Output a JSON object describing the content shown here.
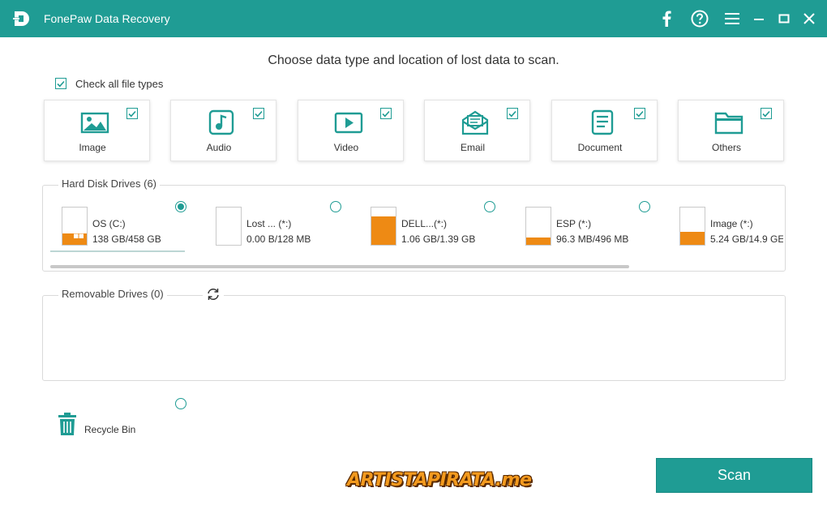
{
  "app": {
    "title": "FonePaw Data Recovery"
  },
  "titlebar_icons": [
    "facebook-icon",
    "help-icon",
    "menu-icon",
    "minimize-icon",
    "maximize-icon",
    "close-icon"
  ],
  "heading": "Choose data type and location of lost data to scan.",
  "check_all": {
    "label": "Check all file types",
    "checked": true
  },
  "file_types": [
    {
      "label": "Image",
      "icon": "image-icon",
      "checked": true
    },
    {
      "label": "Audio",
      "icon": "audio-icon",
      "checked": true
    },
    {
      "label": "Video",
      "icon": "video-icon",
      "checked": true
    },
    {
      "label": "Email",
      "icon": "email-icon",
      "checked": true
    },
    {
      "label": "Document",
      "icon": "document-icon",
      "checked": true
    },
    {
      "label": "Others",
      "icon": "folder-icon",
      "checked": true
    }
  ],
  "hard_disk": {
    "title": "Hard Disk Drives (6)",
    "drives": [
      {
        "name": "OS (C:)",
        "size": "138 GB/458 GB",
        "used_fraction": 0.3,
        "selected": true
      },
      {
        "name": "Lost ... (*:)",
        "size": "0.00  B/128 MB",
        "used_fraction": 0.0,
        "selected": false
      },
      {
        "name": "DELL...(*:)",
        "size": "1.06 GB/1.39 GB",
        "used_fraction": 0.76,
        "selected": false
      },
      {
        "name": "ESP (*:)",
        "size": "96.3 MB/496 MB",
        "used_fraction": 0.19,
        "selected": false
      },
      {
        "name": "Image (*:)",
        "size": "5.24 GB/14.9 GE",
        "used_fraction": 0.35,
        "selected": false
      }
    ]
  },
  "removable": {
    "title": "Removable Drives (0)"
  },
  "recycle_bin": {
    "label": "Recycle Bin",
    "selected": false
  },
  "scan_button": "Scan",
  "watermark": "ARTISTAPIRATA.me",
  "colors": {
    "accent": "#1f9c94",
    "drive_fill": "#ee8a14"
  }
}
